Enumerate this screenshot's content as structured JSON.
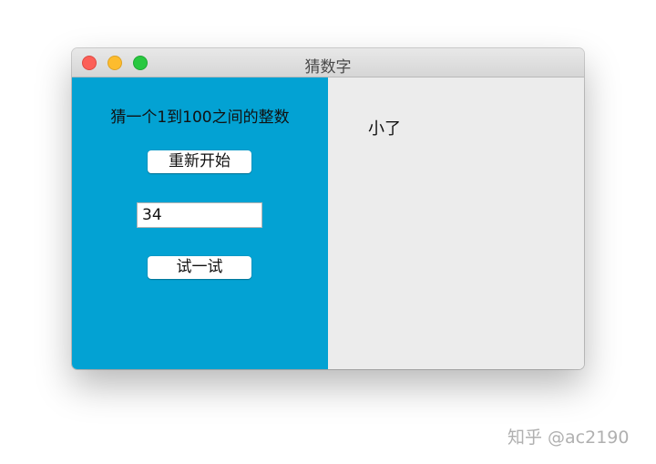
{
  "window": {
    "title": "猜数字"
  },
  "left_panel": {
    "prompt": "猜一个1到100之间的整数",
    "restart_label": "重新开始",
    "guess_value": "34",
    "try_label": "试一试",
    "background_color": "#03a2d3"
  },
  "right_panel": {
    "result_text": "小了"
  },
  "watermark": {
    "text": "知乎 @ac2190"
  }
}
